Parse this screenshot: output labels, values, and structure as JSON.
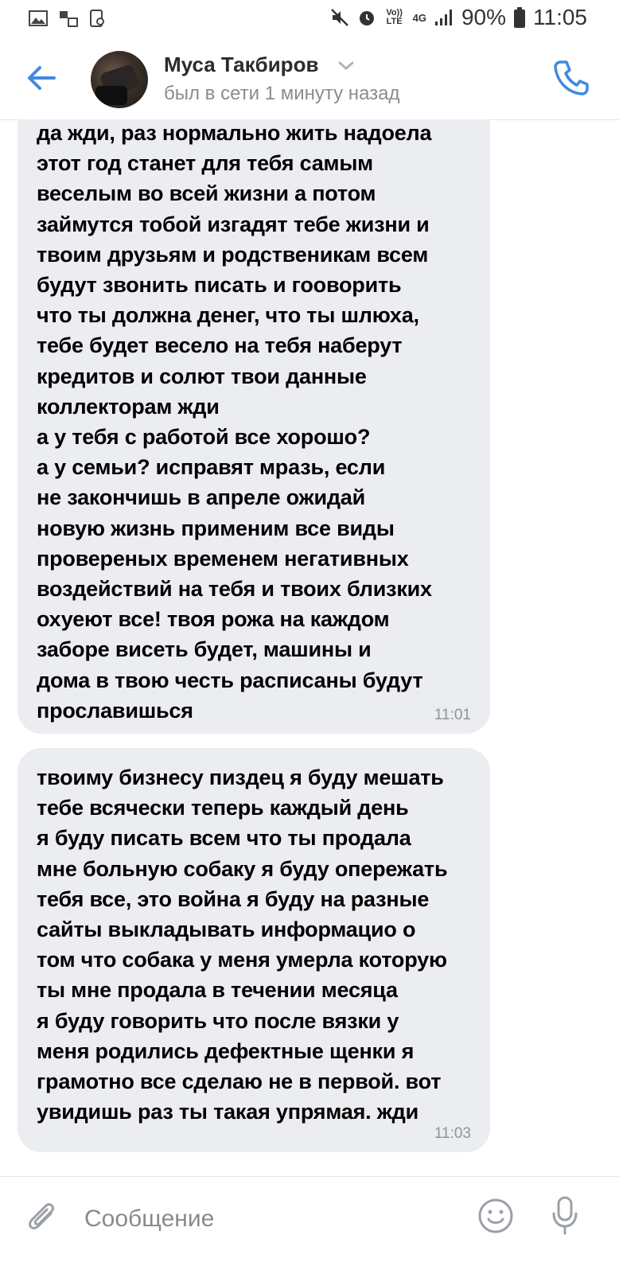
{
  "status_bar": {
    "battery": "90%",
    "time": "11:05",
    "network": "4G",
    "volte": "Vo)) LTE",
    "icons": [
      "image-icon",
      "mute-icon",
      "alarm-icon",
      "signal-icon",
      "battery-icon"
    ]
  },
  "header": {
    "contact_name": "Муса Такбиров",
    "contact_status": "был в сети 1 минуту назад",
    "icons": [
      "back-arrow-icon",
      "avatar",
      "chevron-down-icon",
      "phone-icon"
    ]
  },
  "messages": [
    {
      "text": "да жди, раз нормально жить надоела\nэтот год станет для тебя самым\nвеселым во всей жизни а потом\nзаймутся тобой изгадят тебе жизни и\nтвоим друзьям и родственикам всем\nбудут звонить писать и гооворить\nчто ты должна денег, что ты шлюха,\nтебе будет весело на тебя наберут\nкредитов и солют твои данные\nколлекторам жди\nа у тебя с работой все хорошо?\nа у семьи? исправят мразь, если\nне закончишь в апреле ожидай\nновую жизнь применим все виды\nпровереных временем негативных\nвоздействий на тебя и твоих близких\nохуеют все! твоя рожа на каждом\nзаборе висеть будет, машины и\nдома в твою честь расписаны будут\nпрославишься",
      "time": "11:01"
    },
    {
      "text": "твоиму бизнесу пиздец я буду мешать\nтебе всячески теперь каждый день\nя буду писать всем что ты продала\nмне больную собаку я буду опережать\nтебя все, это война я буду на разные\nсайты выкладывать информацио о\nтом что собака у меня умерла которую\nты мне продала в течении месяца\nя буду говорить что после вязки у\nменя родились дефектные щенки я\nграмотно все сделаю не в первой. вот\nувидишь раз ты такая упрямая. жди",
      "time": "11:03"
    }
  ],
  "composer": {
    "placeholder": "Сообщение",
    "value": "",
    "icons": [
      "attach-icon",
      "emoji-icon",
      "microphone-icon"
    ]
  },
  "colors": {
    "accent": "#3f8ae0",
    "bubble": "#ebedf0",
    "secondary_text": "#8c8c8c"
  }
}
